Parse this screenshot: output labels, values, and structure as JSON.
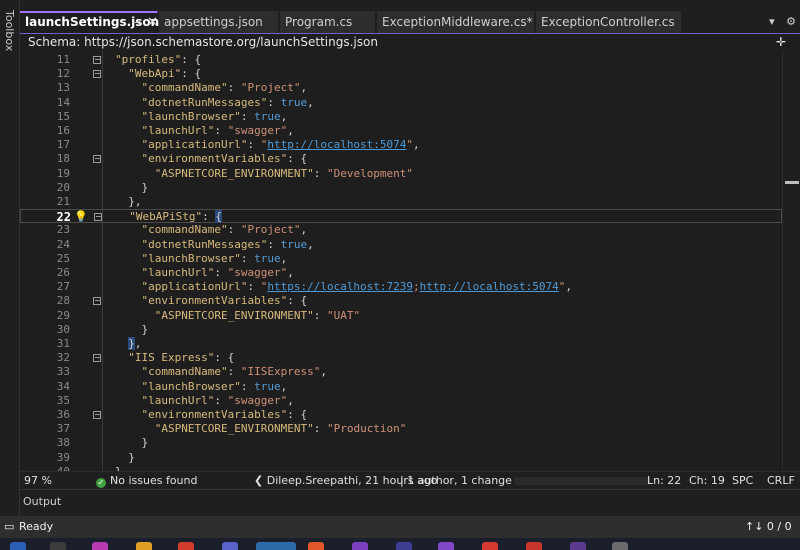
{
  "toolbox": {
    "label": "Toolbox"
  },
  "tabs": [
    {
      "label": "launchSettings.json",
      "active": true
    },
    {
      "label": "appsettings.json",
      "active": false
    },
    {
      "label": "Program.cs",
      "active": false
    },
    {
      "label": "ExceptionMiddleware.cs*",
      "active": false
    },
    {
      "label": "ExceptionController.cs",
      "active": false
    }
  ],
  "tab_actions": {
    "dropdown": "▾",
    "settings": "⚙"
  },
  "schema": {
    "label": "Schema:",
    "url": "https://json.schemastore.org/launchSettings.json",
    "expand": "✛"
  },
  "editor": {
    "current_line": 22,
    "lines": [
      {
        "n": "11",
        "t": "\"profiles\": {"
      },
      {
        "n": "12",
        "t": "  \"WebApi\": {"
      },
      {
        "n": "13",
        "t": "    \"commandName\": \"Project\","
      },
      {
        "n": "14",
        "t": "    \"dotnetRunMessages\": true,"
      },
      {
        "n": "15",
        "t": "    \"launchBrowser\": true,"
      },
      {
        "n": "16",
        "t": "    \"launchUrl\": \"swagger\","
      },
      {
        "n": "17",
        "t": "    \"applicationUrl\": \"http://localhost:5074\","
      },
      {
        "n": "18",
        "t": "    \"environmentVariables\": {"
      },
      {
        "n": "19",
        "t": "      \"ASPNETCORE_ENVIRONMENT\": \"Development\""
      },
      {
        "n": "20",
        "t": "    }"
      },
      {
        "n": "21",
        "t": "  },"
      },
      {
        "n": "22",
        "t": "  \"WebAPiStg\": {"
      },
      {
        "n": "23",
        "t": "    \"commandName\": \"Project\","
      },
      {
        "n": "24",
        "t": "    \"dotnetRunMessages\": true,"
      },
      {
        "n": "25",
        "t": "    \"launchBrowser\": true,"
      },
      {
        "n": "26",
        "t": "    \"launchUrl\": \"swagger\","
      },
      {
        "n": "27",
        "t": "    \"applicationUrl\": \"https://localhost:7239;http://localhost:5074\","
      },
      {
        "n": "28",
        "t": "    \"environmentVariables\": {"
      },
      {
        "n": "29",
        "t": "      \"ASPNETCORE_ENVIRONMENT\": \"UAT\""
      },
      {
        "n": "30",
        "t": "    }"
      },
      {
        "n": "31",
        "t": "  },"
      },
      {
        "n": "32",
        "t": "  \"IIS Express\": {"
      },
      {
        "n": "33",
        "t": "    \"commandName\": \"IISExpress\","
      },
      {
        "n": "34",
        "t": "    \"launchBrowser\": true,"
      },
      {
        "n": "35",
        "t": "    \"launchUrl\": \"swagger\","
      },
      {
        "n": "36",
        "t": "    \"environmentVariables\": {"
      },
      {
        "n": "37",
        "t": "      \"ASPNETCORE_ENVIRONMENT\": \"Production\""
      },
      {
        "n": "38",
        "t": "    }"
      },
      {
        "n": "39",
        "t": "  }"
      },
      {
        "n": "40",
        "t": "}"
      }
    ]
  },
  "editor_status": {
    "zoom": "97 %",
    "issues": "No issues found",
    "git_blame": "Dileep.Sreepathi, 21 hours ago",
    "git_changes": "1 author, 1 change",
    "line": "Ln: 22",
    "col": "Ch: 19",
    "whitespace": "SPC",
    "eol": "CRLF"
  },
  "output": {
    "label": "Output"
  },
  "statusbar": {
    "state": "Ready",
    "sync": "↑↓ 0 / 0"
  },
  "colors": {
    "accent": "#9f73ff",
    "key": "#d7ba7d",
    "string": "#ce9178",
    "keyword": "#569cd6",
    "link": "#4e9bd8"
  }
}
